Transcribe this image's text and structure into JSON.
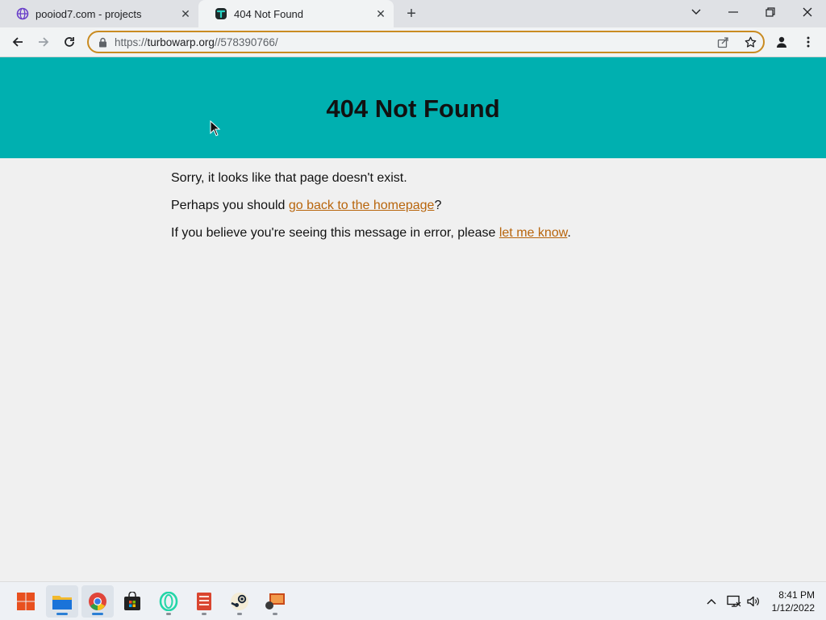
{
  "browser": {
    "tabs": [
      {
        "title": "pooiod7.com - projects",
        "icon": "globe-icon",
        "active": false
      },
      {
        "title": "404 Not Found",
        "icon": "turbowarp-icon",
        "active": true
      }
    ],
    "new_tab_symbol": "+",
    "address": {
      "scheme": "https://",
      "host": "turbowarp.org",
      "path": "//578390766/"
    }
  },
  "page": {
    "heading": "404 Not Found",
    "line1": "Sorry, it looks like that page doesn't exist.",
    "line2_prefix": "Perhaps you should ",
    "line2_link": "go back to the homepage",
    "line2_suffix": "?",
    "line3_prefix": "If you believe you're seeing this message in error, please ",
    "line3_link": "let me know",
    "line3_suffix": ".",
    "banner_color": "#00b0b0",
    "link_color": "#b8650c"
  },
  "taskbar": {
    "apps": [
      "start-icon",
      "file-explorer-icon",
      "chrome-icon",
      "store-icon",
      "opera-gx-icon",
      "notes-icon",
      "steam-icon",
      "app-icon"
    ],
    "clock": {
      "time": "8:41 PM",
      "date": "1/12/2022"
    }
  }
}
